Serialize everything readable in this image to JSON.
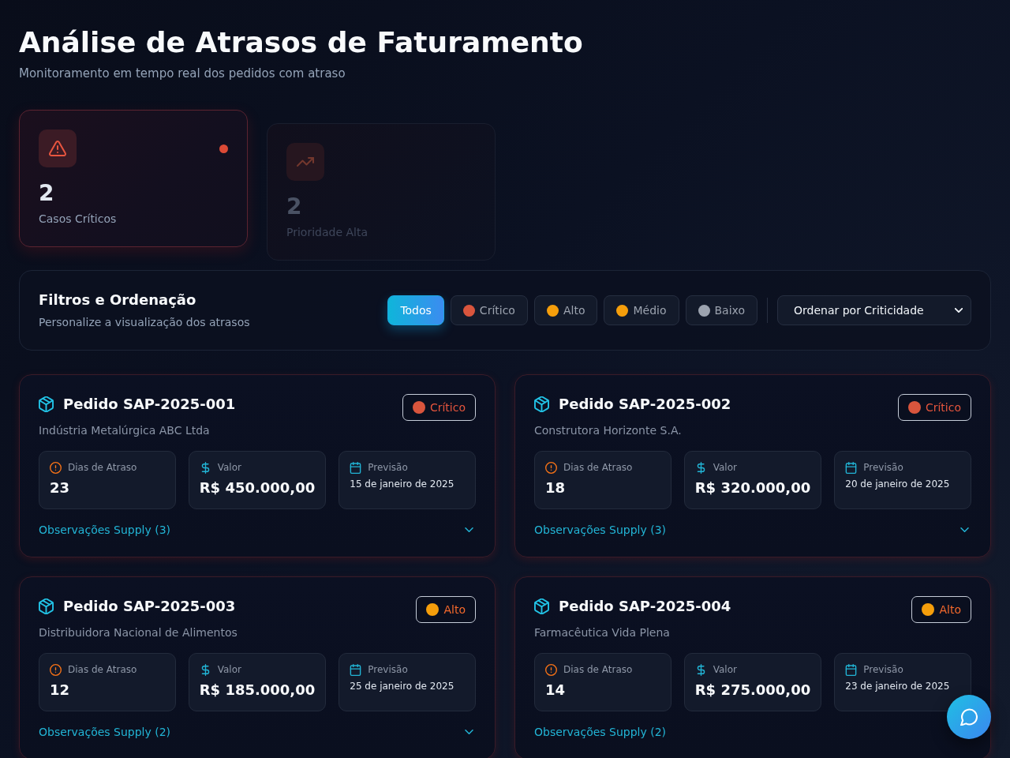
{
  "header": {
    "title": "Análise de Atrasos de Faturamento",
    "subtitle": "Monitoramento em tempo real dos pedidos com atraso"
  },
  "stats": [
    {
      "kind": "critical",
      "value": "2",
      "label": "Casos Críticos",
      "highlighted": true
    },
    {
      "kind": "high",
      "value": "2",
      "label": "Prioridade Alta",
      "highlighted": false
    }
  ],
  "filters": {
    "title": "Filtros e Ordenação",
    "subtitle": "Personalize a visualização dos atrasos",
    "options": [
      {
        "label": "Todos",
        "selected": true
      },
      {
        "label": "Crítico",
        "selected": false,
        "color": "#d9553d"
      },
      {
        "label": "Alto",
        "selected": false,
        "color": "#f59e0b"
      },
      {
        "label": "Médio",
        "selected": false,
        "color": "#f59e0b"
      },
      {
        "label": "Baixo",
        "selected": false,
        "color": "#9ca3af"
      }
    ],
    "sort": {
      "value": "Ordenar por Criticidade"
    }
  },
  "orders": [
    {
      "title": "Pedido SAP-2025-001",
      "client": "Indústria Metalúrgica ABC Ltda",
      "priority": {
        "label": "Crítico",
        "kind": "critical",
        "color": "#d9553d"
      },
      "metrics": [
        {
          "kind": "delay",
          "label": "Dias de Atraso",
          "value": "23"
        },
        {
          "kind": "amount",
          "label": "Valor",
          "value": "R$ 450.000,00"
        },
        {
          "kind": "forecast",
          "label": "Previsão",
          "value": "15 de janeiro de 2025"
        }
      ],
      "notes_link": "Observações Supply (3)",
      "expanded": false
    },
    {
      "title": "Pedido SAP-2025-002",
      "client": "Construtora Horizonte S.A.",
      "priority": {
        "label": "Crítico",
        "kind": "critical",
        "color": "#d9553d"
      },
      "metrics": [
        {
          "kind": "delay",
          "label": "Dias de Atraso",
          "value": "18"
        },
        {
          "kind": "amount",
          "label": "Valor",
          "value": "R$ 320.000,00"
        },
        {
          "kind": "forecast",
          "label": "Previsão",
          "value": "20 de janeiro de 2025"
        }
      ],
      "notes_link": "Observações Supply (3)",
      "expanded": false
    },
    {
      "title": "Pedido SAP-2025-003",
      "client": "Distribuidora Nacional de Alimentos",
      "priority": {
        "label": "Alto",
        "kind": "high",
        "color": "#f59e0b"
      },
      "metrics": [
        {
          "kind": "delay",
          "label": "Dias de Atraso",
          "value": "12"
        },
        {
          "kind": "amount",
          "label": "Valor",
          "value": "R$ 185.000,00"
        },
        {
          "kind": "forecast",
          "label": "Previsão",
          "value": "25 de janeiro de 2025"
        }
      ],
      "notes_link": "Observações Supply (2)",
      "expanded": false
    },
    {
      "title": "Pedido SAP-2025-004",
      "client": "Farmacêutica Vida Plena",
      "priority": {
        "label": "Alto",
        "kind": "high",
        "color": "#f59e0b"
      },
      "metrics": [
        {
          "kind": "delay",
          "label": "Dias de Atraso",
          "value": "14"
        },
        {
          "kind": "amount",
          "label": "Valor",
          "value": "R$ 275.000,00"
        },
        {
          "kind": "forecast",
          "label": "Previsão",
          "value": "23 de janeiro de 2025"
        }
      ],
      "notes_link": "Observações Supply (2)"
    }
  ]
}
